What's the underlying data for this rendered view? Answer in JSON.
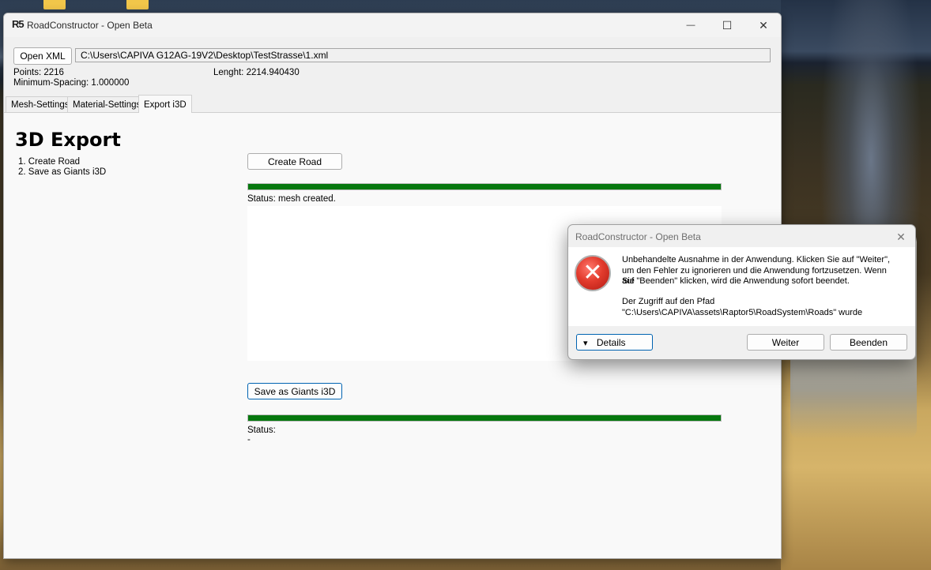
{
  "window": {
    "logo": "R5",
    "title": "RoadConstructor - Open Beta",
    "minimize_glyph": "—",
    "maximize_glyph": "☐",
    "close_glyph": "✕"
  },
  "toolbar": {
    "open_xml_label": "Open XML",
    "file_path": "C:\\Users\\CAPIVA G12AG-19V2\\Desktop\\TestStrasse\\1.xml"
  },
  "info": {
    "points": "Points: 2216",
    "minimum_spacing": "Minimum-Spacing: 1.000000",
    "length": "Lenght: 2214.940430"
  },
  "tabs": [
    {
      "label": "Mesh-Settings",
      "active": false
    },
    {
      "label": "Material-Settings",
      "active": false
    },
    {
      "label": "Export i3D",
      "active": true
    }
  ],
  "export": {
    "heading": "3D Export",
    "steps": [
      "1. Create Road",
      "2. Save as Giants i3D"
    ],
    "create_road_label": "Create Road",
    "create_progress_pct": 100,
    "create_status": "Status: mesh created.",
    "save_label": "Save as Giants i3D",
    "save_progress_pct": 100,
    "save_status": "Status:",
    "save_status_detail": "-"
  },
  "dialog": {
    "title": "RoadConstructor - Open Beta",
    "close_glyph": "✕",
    "icon_glyph": "✕",
    "message_lines": [
      "Unbehandelte Ausnahme in der Anwendung. Klicken Sie auf \"Weiter\",",
      "um den Fehler zu ignorieren und die Anwendung fortzusetzen. Wenn Sie",
      "auf \"Beenden\" klicken, wird die Anwendung sofort beendet."
    ],
    "detail_lines": [
      "Der Zugriff auf den Pfad",
      "\"C:\\Users\\CAPIVA\\assets\\Raptor5\\RoadSystem\\Roads\" wurde"
    ],
    "details_label": "Details",
    "details_glyph": "▾",
    "weiter_label": "Weiter",
    "beenden_label": "Beenden"
  },
  "colors": {
    "progress_fill": "#06780e",
    "focus_border": "#0063b1",
    "error_red": "#e23b2d"
  }
}
